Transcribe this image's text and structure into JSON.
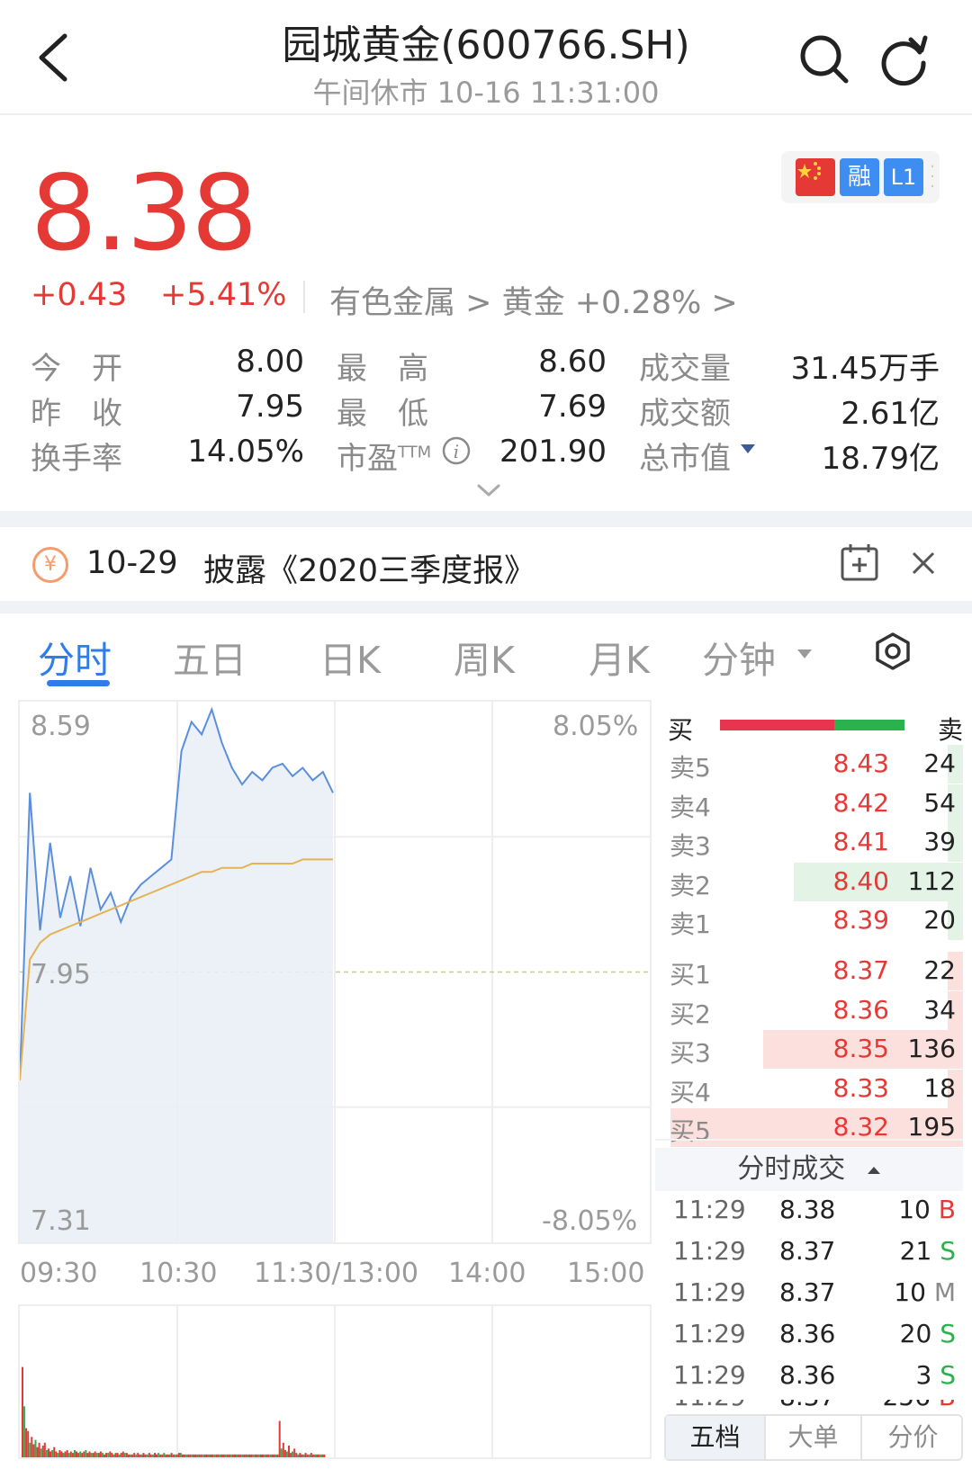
{
  "header": {
    "title": "园城黄金(600766.SH)",
    "subtitle": "午间休市 10-16 11:31:00"
  },
  "quote": {
    "price": "8.38",
    "change": "+0.43",
    "change_pct": "+5.41%",
    "industry": "有色金属 > 黄金 +0.28% >",
    "badge_rong": "融",
    "badge_l1": "L1",
    "stats": [
      {
        "label": "今　开",
        "value": "8.00"
      },
      {
        "label": "最　高",
        "value": "8.60"
      },
      {
        "label": "成交量",
        "value": "31.45万手"
      },
      {
        "label": "昨　收",
        "value": "7.95"
      },
      {
        "label": "最　低",
        "value": "7.69"
      },
      {
        "label": "成交额",
        "value": "2.61亿"
      },
      {
        "label": "换手率",
        "value": "14.05%"
      },
      {
        "label": "市盈TTM",
        "value": "201.90"
      },
      {
        "label": "总市值",
        "value": "18.79亿"
      }
    ],
    "pe_sup": "TTM",
    "pe_base": "市盈"
  },
  "notice": {
    "icon": "¥",
    "date": "10-29",
    "text": "披露《2020三季度报》"
  },
  "tabs": [
    "分时",
    "五日",
    "日K",
    "周K",
    "月K",
    "分钟"
  ],
  "chart": {
    "y_top": "8.59",
    "y_mid": "7.95",
    "y_bot": "7.31",
    "pct_top": "8.05%",
    "pct_bot": "-8.05%",
    "x_labels": [
      "09:30",
      "10:30",
      "11:30/13:00",
      "14:00",
      "15:00"
    ]
  },
  "chart_data": {
    "type": "line",
    "title": "",
    "ylim": [
      7.31,
      8.59
    ],
    "x_labels": [
      "09:30",
      "10:30",
      "11:30/13:00",
      "14:00",
      "15:00"
    ],
    "series": [
      {
        "name": "",
        "values": [
          7.69,
          8.38,
          8.05,
          8.26,
          8.08,
          8.18,
          8.06,
          8.2,
          8.1,
          8.14,
          8.07,
          8.13,
          8.16,
          8.18,
          8.2,
          8.22,
          8.48,
          8.55,
          8.52,
          8.58,
          8.5,
          8.44,
          8.4,
          8.43,
          8.41,
          8.44,
          8.45,
          8.42,
          8.44,
          8.41,
          8.43,
          8.38
        ]
      },
      {
        "name": "",
        "values": [
          7.69,
          7.98,
          8.02,
          8.04,
          8.05,
          8.06,
          8.07,
          8.08,
          8.09,
          8.1,
          8.11,
          8.12,
          8.13,
          8.14,
          8.15,
          8.16,
          8.17,
          8.18,
          8.19,
          8.19,
          8.2,
          8.2,
          8.2,
          8.21,
          8.21,
          8.21,
          8.21,
          8.21,
          8.22,
          8.22,
          8.22,
          8.22
        ]
      }
    ]
  },
  "orderbook": {
    "header_buy": "买",
    "header_sell": "卖",
    "buy_ratio": 0.62,
    "buy_color": "#e8344e",
    "sell_color": "#2bb14e",
    "sells": [
      {
        "label": "卖5",
        "price": "8.43",
        "vol": "24",
        "ratio": 0.05
      },
      {
        "label": "卖4",
        "price": "8.42",
        "vol": "54",
        "ratio": 0.05
      },
      {
        "label": "卖3",
        "price": "8.41",
        "vol": "39",
        "ratio": 0.05
      },
      {
        "label": "卖2",
        "price": "8.40",
        "vol": "112",
        "ratio": 0.55
      },
      {
        "label": "卖1",
        "price": "8.39",
        "vol": "20",
        "ratio": 0.05
      }
    ],
    "buys": [
      {
        "label": "买1",
        "price": "8.37",
        "vol": "22",
        "ratio": 0.05
      },
      {
        "label": "买2",
        "price": "8.36",
        "vol": "34",
        "ratio": 0.05
      },
      {
        "label": "买3",
        "price": "8.35",
        "vol": "136",
        "ratio": 0.65
      },
      {
        "label": "买4",
        "price": "8.33",
        "vol": "18",
        "ratio": 0.05
      },
      {
        "label": "买5",
        "price": "8.32",
        "vol": "195",
        "ratio": 0.95
      }
    ]
  },
  "ticks": {
    "title": "分时成交",
    "rows": [
      {
        "time": "11:29",
        "price": "8.38",
        "vol": "10",
        "side": "B"
      },
      {
        "time": "11:29",
        "price": "8.37",
        "vol": "21",
        "side": "S"
      },
      {
        "time": "11:29",
        "price": "8.37",
        "vol": "10",
        "side": "M"
      },
      {
        "time": "11:29",
        "price": "8.36",
        "vol": "20",
        "side": "S"
      },
      {
        "time": "11:29",
        "price": "8.36",
        "vol": "3",
        "side": "S"
      }
    ]
  },
  "bottom_tabs": [
    "五档",
    "大单",
    "分价"
  ]
}
